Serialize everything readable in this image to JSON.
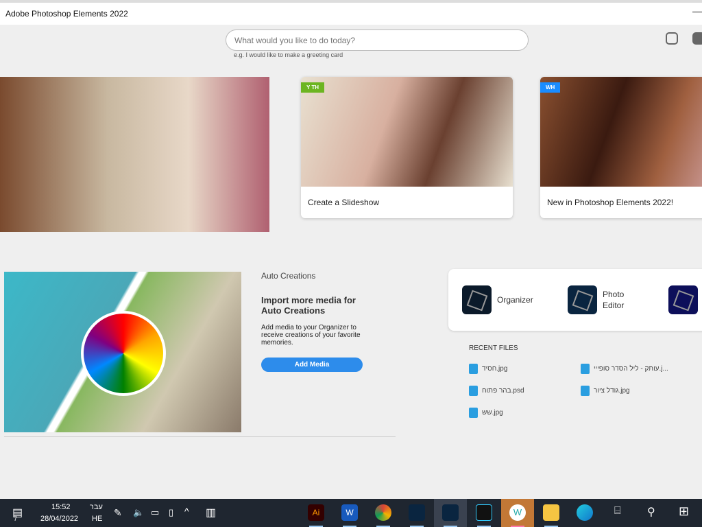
{
  "window": {
    "title": "Adobe Photoshop Elements 2022",
    "minimize": "—"
  },
  "search": {
    "placeholder": "What would you like to do today?",
    "hint": "e.g. I would like to make a greeting card"
  },
  "cards": [
    {
      "badge": "Y TH",
      "caption": "Create a Slideshow"
    },
    {
      "badge": "WH",
      "caption": "New in Photoshop Elements 2022!"
    }
  ],
  "auto": {
    "section": "Auto Creations",
    "heading": "Import more media for Auto Creations",
    "body": "Add media to your Organizer to receive creations of your favorite memories.",
    "button": "Add Media"
  },
  "apps": [
    {
      "label": "Organizer",
      "color": "#0b1a2a"
    },
    {
      "label": "Photo Editor",
      "color": "#0a2540"
    },
    {
      "label": "",
      "color": "#0d0f5a"
    }
  ],
  "recent": {
    "title": "RECENT FILES",
    "files": [
      "חסיד.jpg",
      "עותק - ליל הסדר סופייי.j...",
      "בהר פתוח.psd",
      "גודל ציור.jpg",
      "שש.jpg"
    ]
  },
  "taskbar": {
    "time": "15:52",
    "date": "28/04/2022",
    "lang_top": "עבר",
    "lang": "HE",
    "notif_count": "7",
    "apps": [
      {
        "label": "Ai",
        "color": "#330000"
      },
      {
        "label": "W",
        "color": "#185abd"
      },
      {
        "label": "",
        "color": "#db4437"
      },
      {
        "label": "",
        "color": "#0a2540"
      },
      {
        "label": "",
        "color": "#0a2540"
      },
      {
        "label": "",
        "color": "#111"
      },
      {
        "label": "W",
        "color": "#c27836"
      },
      {
        "label": "",
        "color": "#f5c542"
      },
      {
        "label": "",
        "color": "#1a8ad4"
      }
    ]
  }
}
